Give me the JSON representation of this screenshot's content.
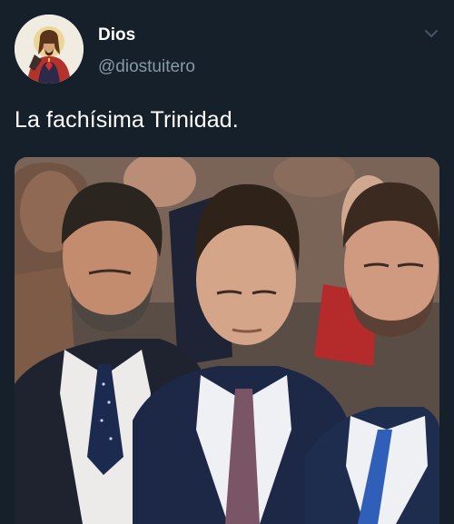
{
  "author": {
    "display_name": "Dios",
    "handle": "@diostuitero",
    "avatar_icon": "sacred-heart-portrait-icon"
  },
  "tweet": {
    "text": "La fachísima Trinidad.",
    "menu_icon": "chevron-down-icon",
    "media_description_icon": "photo-icon"
  },
  "colors": {
    "background": "#15202b",
    "secondary_text": "#8899a6",
    "primary_text": "#ffffff"
  }
}
